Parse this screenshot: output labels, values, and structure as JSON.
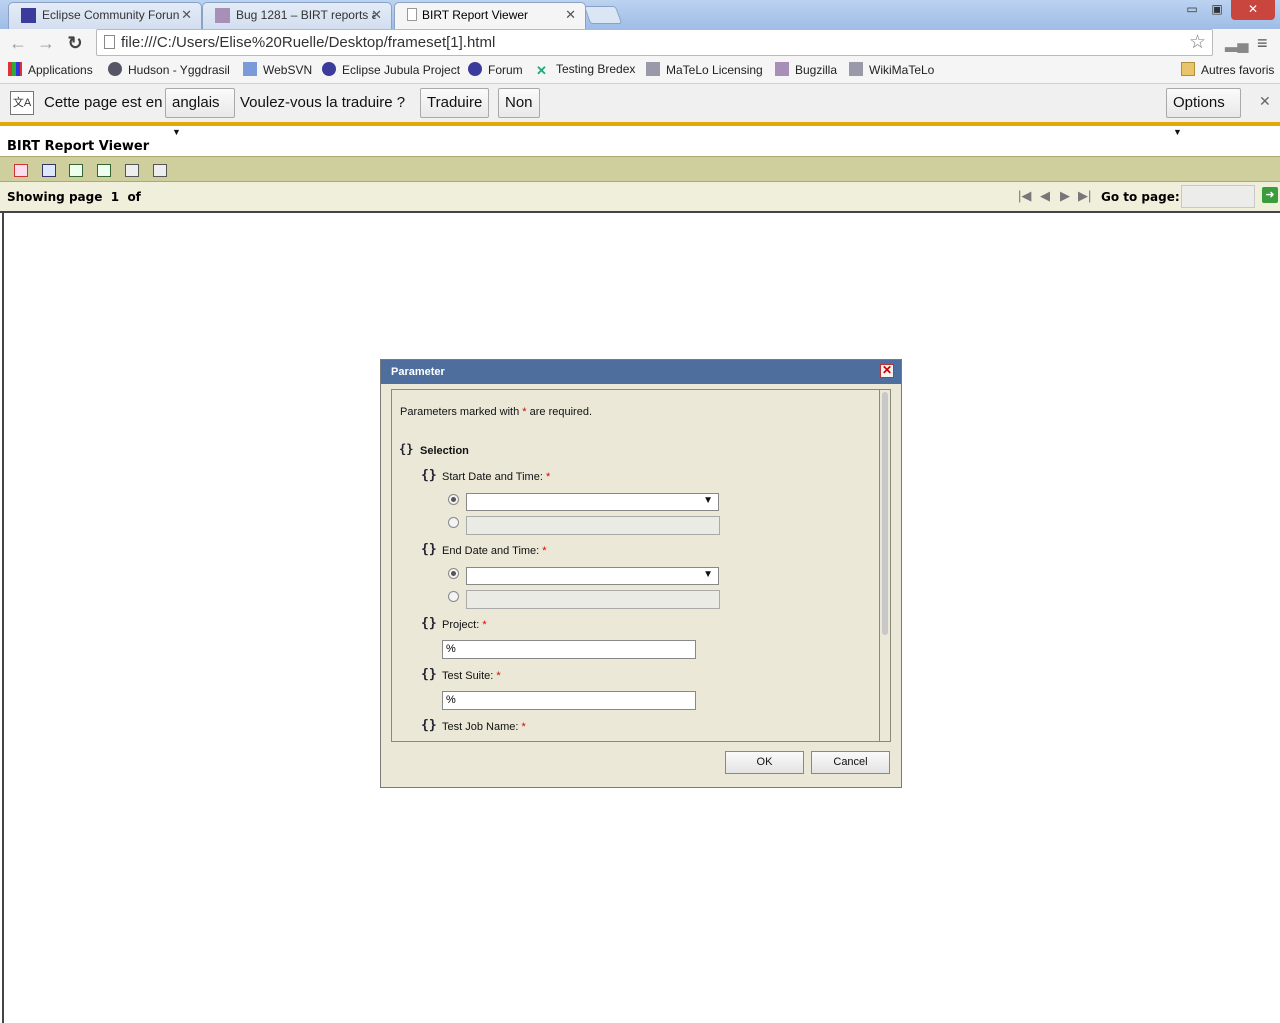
{
  "browser": {
    "tabs": [
      {
        "title": "Eclipse Community Forun",
        "color": "#3b3b9b"
      },
      {
        "title": "Bug 1281 – BIRT reports ar",
        "color": "#a88fb8"
      },
      {
        "title": "BIRT Report Viewer",
        "color": "#ffffff"
      }
    ],
    "window_controls": {
      "minimize": "▭",
      "maximize": "▣",
      "close": "✕"
    },
    "url": "file:///C:/Users/Elise%20Ruelle/Desktop/frameset[1].html",
    "bookmarks": [
      {
        "label": "Applications",
        "icon": "apps-grid-icon"
      },
      {
        "label": "Hudson - Yggdrasil",
        "icon": "hudson-icon"
      },
      {
        "label": "WebSVN",
        "icon": "websvn-icon"
      },
      {
        "label": "Eclipse Jubula Project",
        "icon": "eclipse-icon"
      },
      {
        "label": "Forum",
        "icon": "eclipse-icon"
      },
      {
        "label": "Testing Bredex",
        "icon": "bredex-icon"
      },
      {
        "label": "MaTeLo Licensing",
        "icon": "page-icon"
      },
      {
        "label": "Bugzilla",
        "icon": "bugzilla-icon"
      },
      {
        "label": "WikiMaTeLo",
        "icon": "page-icon"
      }
    ],
    "other_bookmarks": "Autres favoris",
    "translate_bar": {
      "prefix": "Cette page est en",
      "language": "anglais",
      "question": "Voulez-vous la traduire ?",
      "translate_button": "Traduire",
      "no_button": "Non",
      "options_button": "Options"
    }
  },
  "viewer": {
    "title": "BIRT Report Viewer",
    "showing_label": "Showing page",
    "page": "1",
    "of_label": "of",
    "goto_label": "Go to page:",
    "accent_bar": "#cfcf9e"
  },
  "dialog": {
    "title": "Parameter",
    "required_note_prefix": "Parameters marked with",
    "required_star": "*",
    "required_note_suffix": "are required.",
    "group": "Selection",
    "params": {
      "start": "Start Date and Time:",
      "end": "End Date and Time:",
      "project": "Project:",
      "project_value": "%",
      "suite": "Test Suite:",
      "suite_value": "%",
      "job": "Test Job Name:"
    },
    "ok": "OK",
    "cancel": "Cancel"
  }
}
